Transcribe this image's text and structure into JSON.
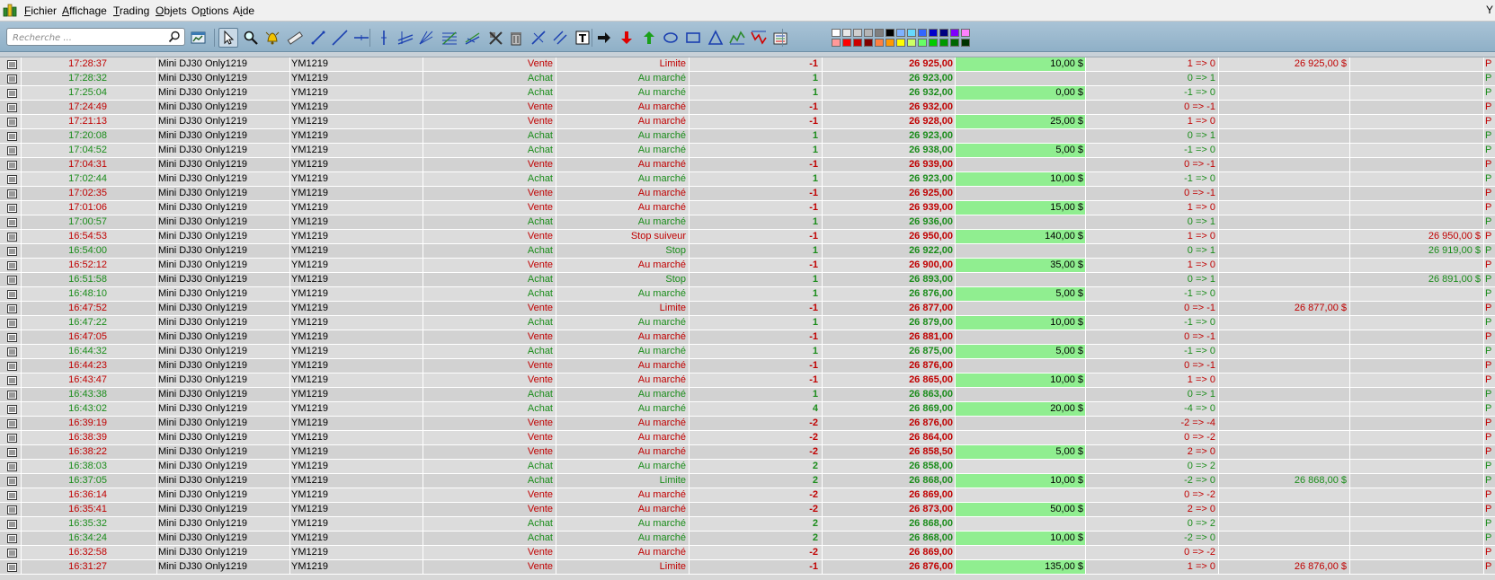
{
  "menu": {
    "items": [
      {
        "label": "Fichier",
        "underline": "F",
        "rest": "ichier"
      },
      {
        "label": "Affichage",
        "underline": "A",
        "rest": "ffichage"
      },
      {
        "label": "Trading",
        "underline": "T",
        "rest": "rading"
      },
      {
        "label": "Objets",
        "underline": "O",
        "rest": "bjets"
      },
      {
        "label": "Options",
        "underline": "p",
        "pre": "O",
        "rest": "tions"
      },
      {
        "label": "Aide",
        "underline": "i",
        "pre": "A",
        "rest": "de"
      }
    ],
    "right_label": "Y"
  },
  "toolbar": {
    "search_placeholder": "Recherche ...",
    "tools": [
      "cursor-arrow",
      "magnifier",
      "alert-bell",
      "ruler",
      "segment-line",
      "line",
      "horizontal-line",
      "vertical-line",
      "channel",
      "fan-lines",
      "fibonacci",
      "pitchfork",
      "delete-tools",
      "trash",
      "cross-line",
      "parallel-lines",
      "text",
      "arrow-right",
      "arrow-down-red",
      "arrow-up-green",
      "ellipse",
      "rectangle",
      "triangle",
      "zigzag-up",
      "zigzag-down",
      "levels"
    ],
    "palette_row1": [
      "#ffffff",
      "#e8e8e8",
      "#cfcfcf",
      "#b5b5b5",
      "#7f7f7f",
      "#000000",
      "#7fb2ff",
      "#66d9ff",
      "#3366ff",
      "#0000cc",
      "#000080",
      "#7f00ff",
      "#ff80ff"
    ],
    "palette_row2": [
      "#ff9999",
      "#ff0000",
      "#cc0000",
      "#800000",
      "#ff8040",
      "#ff9900",
      "#ffff00",
      "#ccff66",
      "#66ff66",
      "#00cc00",
      "#009900",
      "#006600",
      "#003300"
    ]
  },
  "table": {
    "rows": [
      {
        "time": "17:28:37",
        "product": "Mini DJ30 Only1219",
        "code": "YM1219",
        "side": "Vente",
        "type": "Limite",
        "qty": "-1",
        "price": "26 925,00",
        "gain": "10,00 $",
        "pos": "1 => 0",
        "lim": "26 925,00 $",
        "stop": "",
        "last": "P"
      },
      {
        "time": "17:28:32",
        "product": "Mini DJ30 Only1219",
        "code": "YM1219",
        "side": "Achat",
        "type": "Au marché",
        "qty": "1",
        "price": "26 923,00",
        "gain": "",
        "pos": "0 => 1",
        "lim": "",
        "stop": "",
        "last": "P"
      },
      {
        "time": "17:25:04",
        "product": "Mini DJ30 Only1219",
        "code": "YM1219",
        "side": "Achat",
        "type": "Au marché",
        "qty": "1",
        "price": "26 932,00",
        "gain": "0,00 $",
        "pos": "-1 => 0",
        "lim": "",
        "stop": "",
        "last": "P"
      },
      {
        "time": "17:24:49",
        "product": "Mini DJ30 Only1219",
        "code": "YM1219",
        "side": "Vente",
        "type": "Au marché",
        "qty": "-1",
        "price": "26 932,00",
        "gain": "",
        "pos": "0 => -1",
        "lim": "",
        "stop": "",
        "last": "P"
      },
      {
        "time": "17:21:13",
        "product": "Mini DJ30 Only1219",
        "code": "YM1219",
        "side": "Vente",
        "type": "Au marché",
        "qty": "-1",
        "price": "26 928,00",
        "gain": "25,00 $",
        "pos": "1 => 0",
        "lim": "",
        "stop": "",
        "last": "P"
      },
      {
        "time": "17:20:08",
        "product": "Mini DJ30 Only1219",
        "code": "YM1219",
        "side": "Achat",
        "type": "Au marché",
        "qty": "1",
        "price": "26 923,00",
        "gain": "",
        "pos": "0 => 1",
        "lim": "",
        "stop": "",
        "last": "P"
      },
      {
        "time": "17:04:52",
        "product": "Mini DJ30 Only1219",
        "code": "YM1219",
        "side": "Achat",
        "type": "Au marché",
        "qty": "1",
        "price": "26 938,00",
        "gain": "5,00 $",
        "pos": "-1 => 0",
        "lim": "",
        "stop": "",
        "last": "P"
      },
      {
        "time": "17:04:31",
        "product": "Mini DJ30 Only1219",
        "code": "YM1219",
        "side": "Vente",
        "type": "Au marché",
        "qty": "-1",
        "price": "26 939,00",
        "gain": "",
        "pos": "0 => -1",
        "lim": "",
        "stop": "",
        "last": "P"
      },
      {
        "time": "17:02:44",
        "product": "Mini DJ30 Only1219",
        "code": "YM1219",
        "side": "Achat",
        "type": "Au marché",
        "qty": "1",
        "price": "26 923,00",
        "gain": "10,00 $",
        "pos": "-1 => 0",
        "lim": "",
        "stop": "",
        "last": "P"
      },
      {
        "time": "17:02:35",
        "product": "Mini DJ30 Only1219",
        "code": "YM1219",
        "side": "Vente",
        "type": "Au marché",
        "qty": "-1",
        "price": "26 925,00",
        "gain": "",
        "pos": "0 => -1",
        "lim": "",
        "stop": "",
        "last": "P"
      },
      {
        "time": "17:01:06",
        "product": "Mini DJ30 Only1219",
        "code": "YM1219",
        "side": "Vente",
        "type": "Au marché",
        "qty": "-1",
        "price": "26 939,00",
        "gain": "15,00 $",
        "pos": "1 => 0",
        "lim": "",
        "stop": "",
        "last": "P"
      },
      {
        "time": "17:00:57",
        "product": "Mini DJ30 Only1219",
        "code": "YM1219",
        "side": "Achat",
        "type": "Au marché",
        "qty": "1",
        "price": "26 936,00",
        "gain": "",
        "pos": "0 => 1",
        "lim": "",
        "stop": "",
        "last": "P"
      },
      {
        "time": "16:54:53",
        "product": "Mini DJ30 Only1219",
        "code": "YM1219",
        "side": "Vente",
        "type": "Stop suiveur",
        "qty": "-1",
        "price": "26 950,00",
        "gain": "140,00 $",
        "pos": "1 => 0",
        "lim": "",
        "stop": "26 950,00 $",
        "last": "P"
      },
      {
        "time": "16:54:00",
        "product": "Mini DJ30 Only1219",
        "code": "YM1219",
        "side": "Achat",
        "type": "Stop",
        "qty": "1",
        "price": "26 922,00",
        "gain": "",
        "pos": "0 => 1",
        "lim": "",
        "stop": "26 919,00 $",
        "last": "P"
      },
      {
        "time": "16:52:12",
        "product": "Mini DJ30 Only1219",
        "code": "YM1219",
        "side": "Vente",
        "type": "Au marché",
        "qty": "-1",
        "price": "26 900,00",
        "gain": "35,00 $",
        "pos": "1 => 0",
        "lim": "",
        "stop": "",
        "last": "P"
      },
      {
        "time": "16:51:58",
        "product": "Mini DJ30 Only1219",
        "code": "YM1219",
        "side": "Achat",
        "type": "Stop",
        "qty": "1",
        "price": "26 893,00",
        "gain": "",
        "pos": "0 => 1",
        "lim": "",
        "stop": "26 891,00 $",
        "last": "P"
      },
      {
        "time": "16:48:10",
        "product": "Mini DJ30 Only1219",
        "code": "YM1219",
        "side": "Achat",
        "type": "Au marché",
        "qty": "1",
        "price": "26 876,00",
        "gain": "5,00 $",
        "pos": "-1 => 0",
        "lim": "",
        "stop": "",
        "last": "P"
      },
      {
        "time": "16:47:52",
        "product": "Mini DJ30 Only1219",
        "code": "YM1219",
        "side": "Vente",
        "type": "Limite",
        "qty": "-1",
        "price": "26 877,00",
        "gain": "",
        "pos": "0 => -1",
        "lim": "26 877,00 $",
        "stop": "",
        "last": "P"
      },
      {
        "time": "16:47:22",
        "product": "Mini DJ30 Only1219",
        "code": "YM1219",
        "side": "Achat",
        "type": "Au marché",
        "qty": "1",
        "price": "26 879,00",
        "gain": "10,00 $",
        "pos": "-1 => 0",
        "lim": "",
        "stop": "",
        "last": "P"
      },
      {
        "time": "16:47:05",
        "product": "Mini DJ30 Only1219",
        "code": "YM1219",
        "side": "Vente",
        "type": "Au marché",
        "qty": "-1",
        "price": "26 881,00",
        "gain": "",
        "pos": "0 => -1",
        "lim": "",
        "stop": "",
        "last": "P"
      },
      {
        "time": "16:44:32",
        "product": "Mini DJ30 Only1219",
        "code": "YM1219",
        "side": "Achat",
        "type": "Au marché",
        "qty": "1",
        "price": "26 875,00",
        "gain": "5,00 $",
        "pos": "-1 => 0",
        "lim": "",
        "stop": "",
        "last": "P"
      },
      {
        "time": "16:44:23",
        "product": "Mini DJ30 Only1219",
        "code": "YM1219",
        "side": "Vente",
        "type": "Au marché",
        "qty": "-1",
        "price": "26 876,00",
        "gain": "",
        "pos": "0 => -1",
        "lim": "",
        "stop": "",
        "last": "P"
      },
      {
        "time": "16:43:47",
        "product": "Mini DJ30 Only1219",
        "code": "YM1219",
        "side": "Vente",
        "type": "Au marché",
        "qty": "-1",
        "price": "26 865,00",
        "gain": "10,00 $",
        "pos": "1 => 0",
        "lim": "",
        "stop": "",
        "last": "P"
      },
      {
        "time": "16:43:38",
        "product": "Mini DJ30 Only1219",
        "code": "YM1219",
        "side": "Achat",
        "type": "Au marché",
        "qty": "1",
        "price": "26 863,00",
        "gain": "",
        "pos": "0 => 1",
        "lim": "",
        "stop": "",
        "last": "P"
      },
      {
        "time": "16:43:02",
        "product": "Mini DJ30 Only1219",
        "code": "YM1219",
        "side": "Achat",
        "type": "Au marché",
        "qty": "4",
        "price": "26 869,00",
        "gain": "20,00 $",
        "pos": "-4 => 0",
        "lim": "",
        "stop": "",
        "last": "P"
      },
      {
        "time": "16:39:19",
        "product": "Mini DJ30 Only1219",
        "code": "YM1219",
        "side": "Vente",
        "type": "Au marché",
        "qty": "-2",
        "price": "26 876,00",
        "gain": "",
        "pos": "-2 => -4",
        "lim": "",
        "stop": "",
        "last": "P"
      },
      {
        "time": "16:38:39",
        "product": "Mini DJ30 Only1219",
        "code": "YM1219",
        "side": "Vente",
        "type": "Au marché",
        "qty": "-2",
        "price": "26 864,00",
        "gain": "",
        "pos": "0 => -2",
        "lim": "",
        "stop": "",
        "last": "P"
      },
      {
        "time": "16:38:22",
        "product": "Mini DJ30 Only1219",
        "code": "YM1219",
        "side": "Vente",
        "type": "Au marché",
        "qty": "-2",
        "price": "26 858,50",
        "gain": "5,00 $",
        "pos": "2 => 0",
        "lim": "",
        "stop": "",
        "last": "P"
      },
      {
        "time": "16:38:03",
        "product": "Mini DJ30 Only1219",
        "code": "YM1219",
        "side": "Achat",
        "type": "Au marché",
        "qty": "2",
        "price": "26 858,00",
        "gain": "",
        "pos": "0 => 2",
        "lim": "",
        "stop": "",
        "last": "P"
      },
      {
        "time": "16:37:05",
        "product": "Mini DJ30 Only1219",
        "code": "YM1219",
        "side": "Achat",
        "type": "Limite",
        "qty": "2",
        "price": "26 868,00",
        "gain": "10,00 $",
        "pos": "-2 => 0",
        "lim": "26 868,00 $",
        "stop": "",
        "last": "P"
      },
      {
        "time": "16:36:14",
        "product": "Mini DJ30 Only1219",
        "code": "YM1219",
        "side": "Vente",
        "type": "Au marché",
        "qty": "-2",
        "price": "26 869,00",
        "gain": "",
        "pos": "0 => -2",
        "lim": "",
        "stop": "",
        "last": "P"
      },
      {
        "time": "16:35:41",
        "product": "Mini DJ30 Only1219",
        "code": "YM1219",
        "side": "Vente",
        "type": "Au marché",
        "qty": "-2",
        "price": "26 873,00",
        "gain": "50,00 $",
        "pos": "2 => 0",
        "lim": "",
        "stop": "",
        "last": "P"
      },
      {
        "time": "16:35:32",
        "product": "Mini DJ30 Only1219",
        "code": "YM1219",
        "side": "Achat",
        "type": "Au marché",
        "qty": "2",
        "price": "26 868,00",
        "gain": "",
        "pos": "0 => 2",
        "lim": "",
        "stop": "",
        "last": "P"
      },
      {
        "time": "16:34:24",
        "product": "Mini DJ30 Only1219",
        "code": "YM1219",
        "side": "Achat",
        "type": "Au marché",
        "qty": "2",
        "price": "26 868,00",
        "gain": "10,00 $",
        "pos": "-2 => 0",
        "lim": "",
        "stop": "",
        "last": "P"
      },
      {
        "time": "16:32:58",
        "product": "Mini DJ30 Only1219",
        "code": "YM1219",
        "side": "Vente",
        "type": "Au marché",
        "qty": "-2",
        "price": "26 869,00",
        "gain": "",
        "pos": "0 => -2",
        "lim": "",
        "stop": "",
        "last": "P"
      },
      {
        "time": "16:31:27",
        "product": "Mini DJ30 Only1219",
        "code": "YM1219",
        "side": "Vente",
        "type": "Limite",
        "qty": "-1",
        "price": "26 876,00",
        "gain": "135,00 $",
        "pos": "1 => 0",
        "lim": "26 876,00 $",
        "stop": "",
        "last": "P"
      }
    ]
  },
  "colors": {
    "sell": "#c00000",
    "buy": "#1a8c1a",
    "gain_highlight": "#90ee90",
    "toolbar_top": "#a9c3d6",
    "toolbar_bottom": "#8fb0c7"
  }
}
